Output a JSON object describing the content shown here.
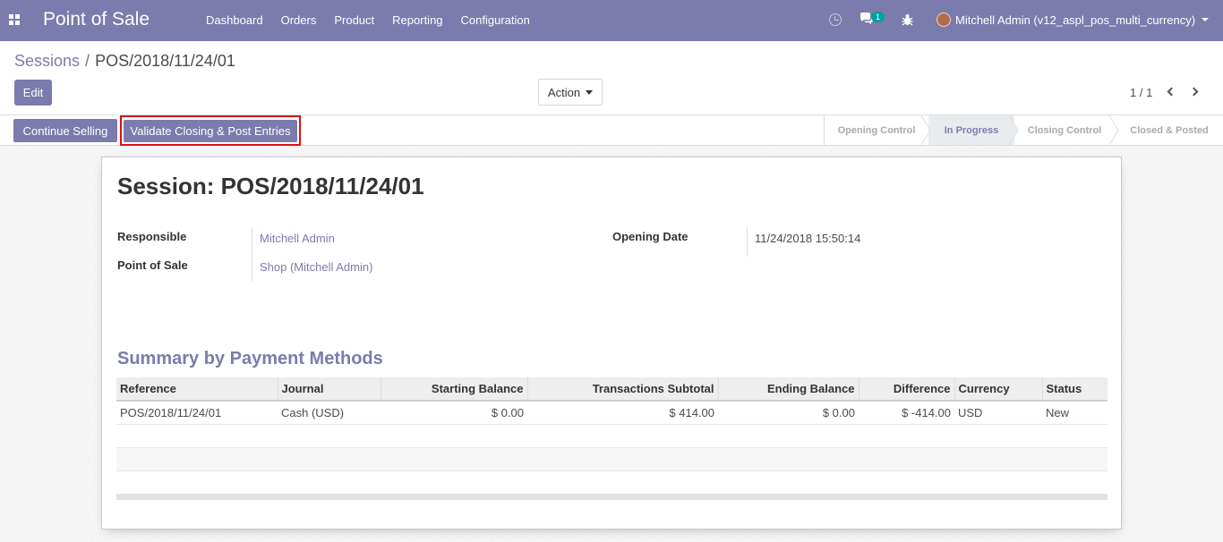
{
  "app": {
    "title": "Point of Sale",
    "menu": [
      "Dashboard",
      "Orders",
      "Product",
      "Reporting",
      "Configuration"
    ],
    "chat_count": "1",
    "user": "Mitchell Admin (v12_aspl_pos_multi_currency)"
  },
  "breadcrumb": {
    "parent": "Sessions",
    "separator": "/",
    "current": "POS/2018/11/24/01"
  },
  "controls": {
    "edit_label": "Edit",
    "action_label": "Action",
    "pager": "1 / 1"
  },
  "statusbar": {
    "continue_label": "Continue Selling",
    "validate_label": "Validate Closing & Post Entries",
    "stages": [
      "Opening Control",
      "In Progress",
      "Closing Control",
      "Closed & Posted"
    ],
    "active_stage": "In Progress"
  },
  "session": {
    "title": "Session: POS/2018/11/24/01",
    "responsible_label": "Responsible",
    "responsible_value": "Mitchell Admin",
    "pos_label": "Point of Sale",
    "pos_value": "Shop (Mitchell Admin)",
    "opening_label": "Opening Date",
    "opening_value": "11/24/2018 15:50:14"
  },
  "summary": {
    "title": "Summary by Payment Methods",
    "columns": [
      "Reference",
      "Journal",
      "Starting Balance",
      "Transactions Subtotal",
      "Ending Balance",
      "Difference",
      "Currency",
      "Status"
    ],
    "rows": [
      [
        "POS/2018/11/24/01",
        "Cash (USD)",
        "$ 0.00",
        "$ 414.00",
        "$ 0.00",
        "$ -414.00",
        "USD",
        "New"
      ]
    ]
  },
  "colors": {
    "brand": "#7c7bad",
    "highlight_border": "#e0100f",
    "badge": "#00a09d"
  }
}
